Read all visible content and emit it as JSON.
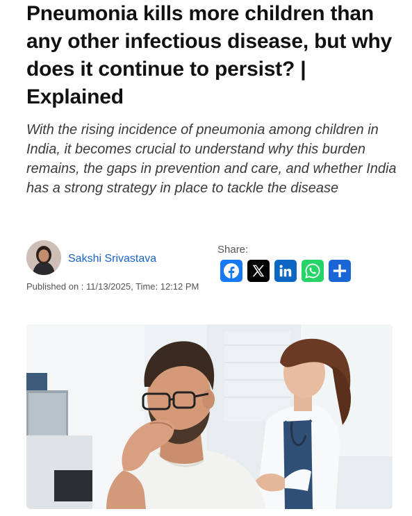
{
  "article": {
    "headline": "Pneumonia kills more children than any other infectious disease, but why does it continue to persist? | Explained",
    "subheadline": "With the rising incidence of pneumonia among children in India, it becomes crucial to understand why this burden remains, the gaps in prevention and care, and whether India has a strong strategy in place to tackle the disease"
  },
  "author": {
    "name": "Sakshi Srivastava",
    "published": "Published on : 11/13/2025, Time: 12:12 PM"
  },
  "share": {
    "label": "Share:",
    "buttons": [
      {
        "name": "facebook",
        "icon": "facebook-icon",
        "color": "#1877f2"
      },
      {
        "name": "x",
        "icon": "x-icon",
        "color": "#000000"
      },
      {
        "name": "linkedin",
        "icon": "linkedin-icon",
        "color": "#0a66c2"
      },
      {
        "name": "whatsapp",
        "icon": "whatsapp-icon",
        "color": "#25d366"
      },
      {
        "name": "share",
        "icon": "plus-share-icon",
        "color": "#1a66d6"
      }
    ]
  },
  "colors": {
    "accent_link": "#1a62c7",
    "headline_text": "#111111",
    "subhead_text": "#3a3a3a"
  }
}
